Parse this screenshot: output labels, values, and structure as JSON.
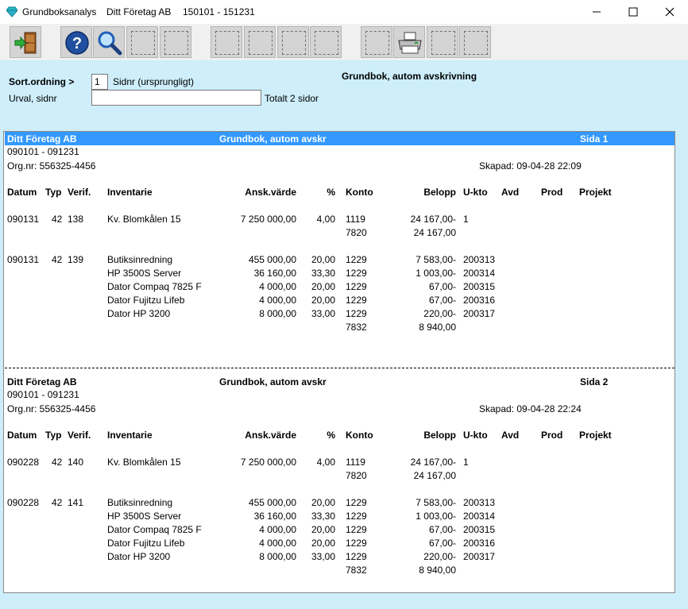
{
  "title": {
    "app_name": "Grundboksanalys",
    "company": "Ditt Företag AB",
    "period": "150101 - 151231"
  },
  "icons": {
    "app": "diamond-icon",
    "exit": "exit-door-icon",
    "help": "help-icon",
    "search": "magnifier-icon",
    "print": "printer-icon"
  },
  "controls": {
    "sort_label": "Sort.ordning >",
    "sort_value": "1",
    "sort_desc": "Sidnr (ursprungligt)",
    "selection_label": "Urval, sidnr",
    "selection_value": "",
    "total_pages": "Totalt 2 sidor",
    "report_title": "Grundbok, autom avskrivning"
  },
  "colors": {
    "background": "#cdeefa",
    "selected_header": "#3399ff"
  },
  "report": {
    "columns": [
      "Datum",
      "Typ",
      "Verif.",
      "Inventarie",
      "Ansk.värde",
      "%",
      "Konto",
      "Belopp",
      "U-kto",
      "Avd",
      "Prod",
      "Projekt"
    ],
    "pages": [
      {
        "company": "Ditt Företag AB",
        "title": "Grundbok, autom avskr",
        "page": "Sida 1",
        "period": "090101 - 091231",
        "org": "Org.nr: 556325-4456",
        "created": "Skapad:  09-04-28  22:09",
        "entries": [
          {
            "date": "090131",
            "typ": "42",
            "verif": "138",
            "lines": [
              {
                "item": "Kv. Blomkålen 15",
                "value": "7 250 000,00",
                "pct": "4,00",
                "konto": "1119",
                "amount": "24 167,00-",
                "ukto": "1"
              },
              {
                "item": "",
                "value": "",
                "pct": "",
                "konto": "7820",
                "amount": "24 167,00",
                "ukto": ""
              }
            ]
          },
          {
            "date": "090131",
            "typ": "42",
            "verif": "139",
            "lines": [
              {
                "item": "Butiksinredning",
                "value": "455 000,00",
                "pct": "20,00",
                "konto": "1229",
                "amount": "7 583,00-",
                "ukto": "200313"
              },
              {
                "item": "HP 3500S Server",
                "value": "36 160,00",
                "pct": "33,30",
                "konto": "1229",
                "amount": "1 003,00-",
                "ukto": "200314"
              },
              {
                "item": "Dator Compaq 7825 F",
                "value": "4 000,00",
                "pct": "20,00",
                "konto": "1229",
                "amount": "67,00-",
                "ukto": "200315"
              },
              {
                "item": "Dator Fujitzu Lifeb",
                "value": "4 000,00",
                "pct": "20,00",
                "konto": "1229",
                "amount": "67,00-",
                "ukto": "200316"
              },
              {
                "item": "Dator HP 3200",
                "value": "8 000,00",
                "pct": "33,00",
                "konto": "1229",
                "amount": "220,00-",
                "ukto": "200317"
              },
              {
                "item": "",
                "value": "",
                "pct": "",
                "konto": "7832",
                "amount": "8 940,00",
                "ukto": ""
              }
            ]
          }
        ]
      },
      {
        "company": "Ditt Företag AB",
        "title": "Grundbok, autom avskr",
        "page": "Sida 2",
        "period": "090101 - 091231",
        "org": "Org.nr: 556325-4456",
        "created": "Skapad:  09-04-28  22:24",
        "entries": [
          {
            "date": "090228",
            "typ": "42",
            "verif": "140",
            "lines": [
              {
                "item": "Kv. Blomkålen 15",
                "value": "7 250 000,00",
                "pct": "4,00",
                "konto": "1119",
                "amount": "24 167,00-",
                "ukto": "1"
              },
              {
                "item": "",
                "value": "",
                "pct": "",
                "konto": "7820",
                "amount": "24 167,00",
                "ukto": ""
              }
            ]
          },
          {
            "date": "090228",
            "typ": "42",
            "verif": "141",
            "lines": [
              {
                "item": "Butiksinredning",
                "value": "455 000,00",
                "pct": "20,00",
                "konto": "1229",
                "amount": "7 583,00-",
                "ukto": "200313"
              },
              {
                "item": "HP 3500S Server",
                "value": "36 160,00",
                "pct": "33,30",
                "konto": "1229",
                "amount": "1 003,00-",
                "ukto": "200314"
              },
              {
                "item": "Dator Compaq 7825 F",
                "value": "4 000,00",
                "pct": "20,00",
                "konto": "1229",
                "amount": "67,00-",
                "ukto": "200315"
              },
              {
                "item": "Dator Fujitzu Lifeb",
                "value": "4 000,00",
                "pct": "20,00",
                "konto": "1229",
                "amount": "67,00-",
                "ukto": "200316"
              },
              {
                "item": "Dator HP 3200",
                "value": "8 000,00",
                "pct": "33,00",
                "konto": "1229",
                "amount": "220,00-",
                "ukto": "200317"
              },
              {
                "item": "",
                "value": "",
                "pct": "",
                "konto": "7832",
                "amount": "8 940,00",
                "ukto": ""
              }
            ]
          }
        ]
      }
    ]
  }
}
